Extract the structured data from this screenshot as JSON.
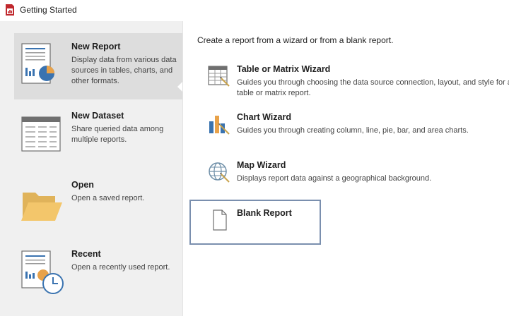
{
  "window": {
    "title": "Getting Started",
    "icon": "report-builder-app-icon"
  },
  "sidebar": {
    "items": [
      {
        "title": "New Report",
        "description": "Display data from various data sources in tables, charts, and other formats.",
        "icon": "new-report-icon",
        "selected": true
      },
      {
        "title": "New Dataset",
        "description": "Share queried data among multiple reports.",
        "icon": "new-dataset-icon",
        "selected": false
      },
      {
        "title": "Open",
        "description": "Open a saved report.",
        "icon": "folder-icon",
        "selected": false
      },
      {
        "title": "Recent",
        "description": "Open a recently used report.",
        "icon": "recent-report-clock-icon",
        "selected": false
      }
    ]
  },
  "main": {
    "intro": "Create a report from a wizard or from a blank report.",
    "options": [
      {
        "title": "Table or Matrix Wizard",
        "description": "Guides you through choosing the data source connection, layout, and style for a table or matrix report.",
        "icon": "table-wizard-icon"
      },
      {
        "title": "Chart Wizard",
        "description": "Guides you through creating column, line, pie, bar, and area charts.",
        "icon": "chart-wizard-icon"
      },
      {
        "title": "Map Wizard",
        "description": "Displays report data against a geographical background.",
        "icon": "map-wizard-icon"
      },
      {
        "title": "Blank Report",
        "description": "",
        "icon": "blank-page-icon",
        "focused": true
      }
    ]
  },
  "colors": {
    "sidebar_bg": "#f0f0f0",
    "selected_bg": "#dddddd",
    "focus_border": "#7a8fae",
    "folder": "#f3c66b",
    "chart_blue": "#3a73b0",
    "chart_orange": "#e8a24a"
  }
}
